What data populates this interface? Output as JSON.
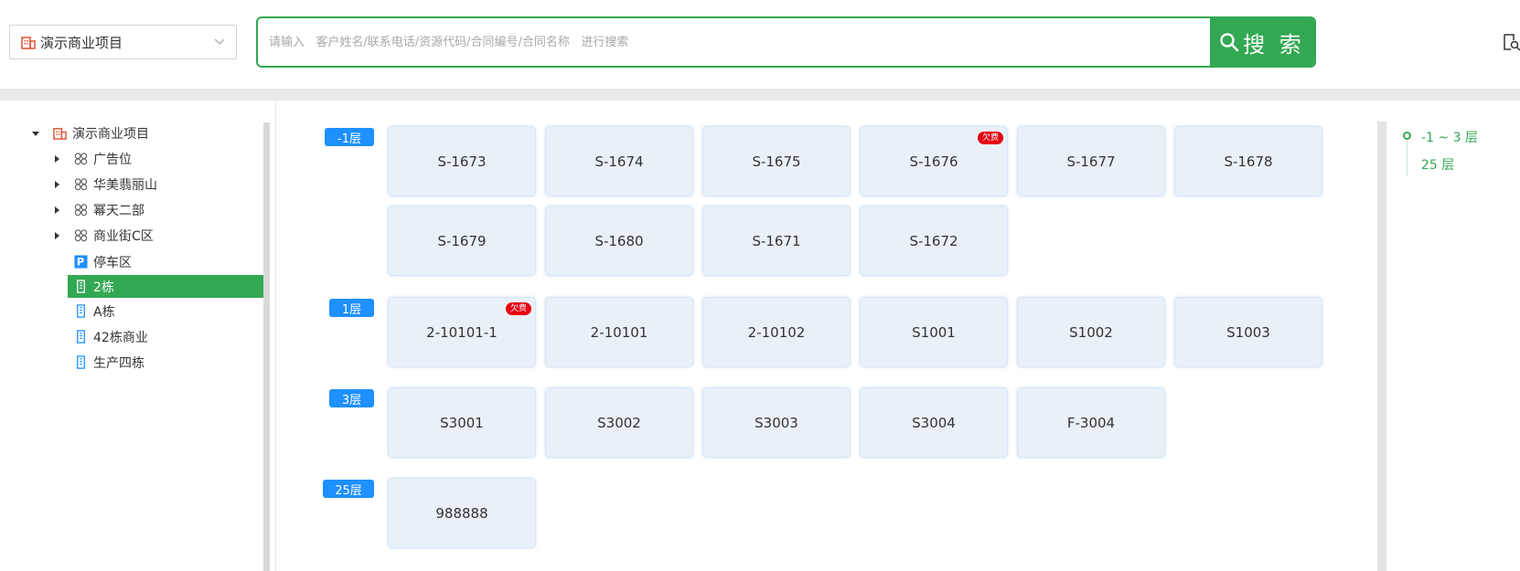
{
  "header": {
    "project_select": {
      "value": "演示商业项目"
    },
    "search": {
      "placeholder": "请输入   客户姓名/联系电话/资源代码/合同编号/合同名称   进行搜索",
      "button_label": "搜 索"
    }
  },
  "tree": {
    "root": {
      "label": "演示商业项目"
    },
    "items": [
      {
        "label": "广告位"
      },
      {
        "label": "华美翡丽山"
      },
      {
        "label": "幂天二部"
      },
      {
        "label": "商业街C区"
      },
      {
        "label": "停车区"
      },
      {
        "label": "2栋"
      },
      {
        "label": "A栋"
      },
      {
        "label": "42栋商业"
      },
      {
        "label": "生产四栋"
      }
    ]
  },
  "floors": [
    {
      "label": "-1层",
      "units": [
        {
          "code": "S-1673"
        },
        {
          "code": "S-1674"
        },
        {
          "code": "S-1675"
        },
        {
          "code": "S-1676",
          "badge": "欠费"
        },
        {
          "code": "S-1677"
        },
        {
          "code": "S-1678"
        },
        {
          "code": "S-1679"
        },
        {
          "code": "S-1680"
        },
        {
          "code": "S-1671"
        },
        {
          "code": "S-1672"
        }
      ]
    },
    {
      "label": "1层",
      "units": [
        {
          "code": "2-10101-1",
          "badge": "欠费"
        },
        {
          "code": "2-10101"
        },
        {
          "code": "2-10102"
        },
        {
          "code": "S1001"
        },
        {
          "code": "S1002"
        },
        {
          "code": "S1003"
        }
      ]
    },
    {
      "label": "3层",
      "units": [
        {
          "code": "S3001"
        },
        {
          "code": "S3002"
        },
        {
          "code": "S3003"
        },
        {
          "code": "S3004"
        },
        {
          "code": "F-3004"
        }
      ]
    },
    {
      "label": "25层",
      "units": [
        {
          "code": "988888"
        }
      ]
    }
  ],
  "floor_nav": {
    "items": [
      {
        "label": "-1 ~ 3 层"
      },
      {
        "label": "25 层"
      }
    ]
  },
  "colors": {
    "accent": "#33a852",
    "floor_badge": "#1e90ff",
    "owe_badge": "#e60012",
    "unit_bg": "#e9f0f8"
  }
}
